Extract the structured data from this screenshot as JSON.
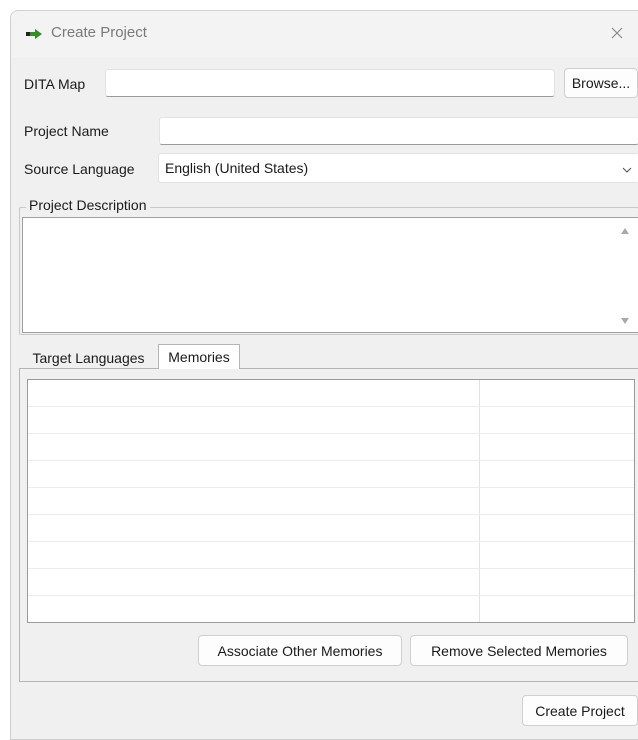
{
  "window": {
    "title": "Create Project",
    "icons": {
      "app": "green-arrow-icon",
      "close": "close-icon"
    }
  },
  "form": {
    "dita_map": {
      "label": "DITA Map",
      "value": "",
      "browse_label": "Browse..."
    },
    "project_name": {
      "label": "Project Name",
      "value": ""
    },
    "source_language": {
      "label": "Source Language",
      "value": "English (United States)"
    },
    "project_description": {
      "label": "Project Description",
      "value": ""
    }
  },
  "tabs": {
    "items": [
      {
        "label": "Target Languages",
        "active": false
      },
      {
        "label": "Memories",
        "active": true
      }
    ]
  },
  "memories": {
    "rows": [
      [
        "",
        ""
      ],
      [
        "",
        ""
      ],
      [
        "",
        ""
      ],
      [
        "",
        ""
      ],
      [
        "",
        ""
      ],
      [
        "",
        ""
      ],
      [
        "",
        ""
      ],
      [
        "",
        ""
      ],
      [
        "",
        ""
      ]
    ],
    "associate_label": "Associate Other Memories",
    "remove_label": "Remove Selected Memories"
  },
  "footer": {
    "create_label": "Create Project"
  },
  "colors": {
    "accent": "#3a8a2a",
    "window_bg": "#f0f0f0"
  }
}
